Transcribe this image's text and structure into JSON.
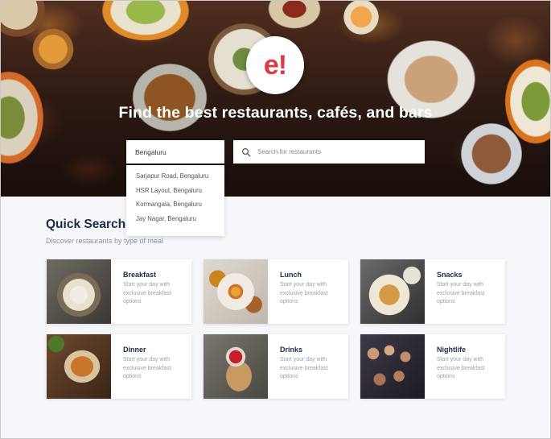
{
  "brand": {
    "logo_text": "e!",
    "accent": "#e23744"
  },
  "hero": {
    "title": "Find the best restaurants, cafés, and bars",
    "location_value": "Bengaluru",
    "search_placeholder": "Search for restaurants",
    "search_icon": "search-icon"
  },
  "location_dropdown": {
    "options": [
      "Sarjapur Road, Bengaluru",
      "HSR Layout, Bengaluru",
      "Kormangala, Bengaluru",
      "Jay Nagar, Bengaluru"
    ]
  },
  "quick_searches": {
    "title": "Quick Searches",
    "subtitle": "Discover restaurants by type of meal",
    "cards": [
      {
        "title": "Breakfast",
        "description": "Start your day with exclusive breakfast options"
      },
      {
        "title": "Lunch",
        "description": "Start your day with exclusive breakfast options"
      },
      {
        "title": "Snacks",
        "description": "Start your day with exclusive breakfast options"
      },
      {
        "title": "Dinner",
        "description": "Start your day with exclusive breakfast options"
      },
      {
        "title": "Drinks",
        "description": "Start your day with exclusive breakfast options"
      },
      {
        "title": "Nightlife",
        "description": "Start your day with exclusive breakfast options"
      }
    ]
  }
}
